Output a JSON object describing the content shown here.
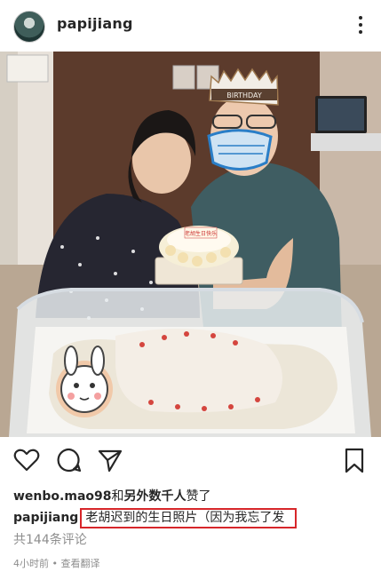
{
  "post": {
    "username": "papijiang",
    "likes_user": "wenbo.mao98",
    "likes_and": "和",
    "likes_others": "另外数千人",
    "likes_suffix": "赞了",
    "caption_text": "老胡迟到的生日照片（因为我忘了发",
    "comments": "共144条评论",
    "time": "4小时前",
    "separator": " • ",
    "translate": "查看翻译"
  },
  "photo": {
    "hat_text": "BIRTHDAY",
    "cake_text": "老胡生日快乐"
  },
  "icons": {
    "more": "more-options-icon",
    "like": "heart-icon",
    "comment": "comment-icon",
    "share": "paper-plane-icon",
    "save": "bookmark-icon"
  }
}
